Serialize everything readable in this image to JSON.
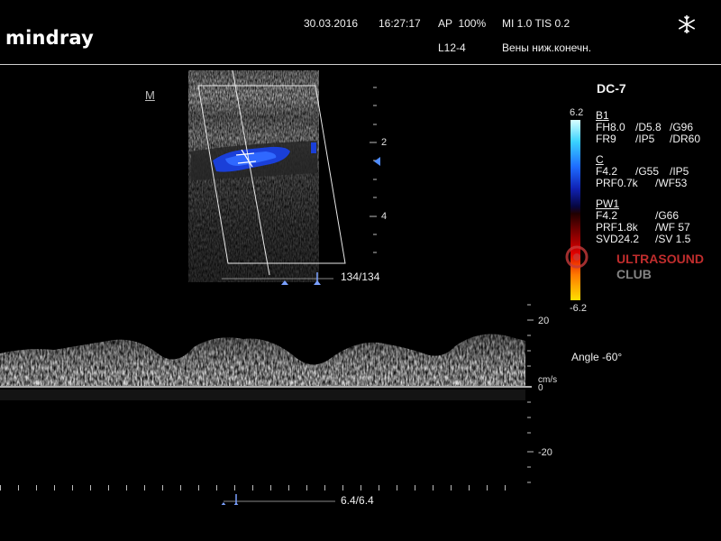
{
  "header": {
    "brand": "mindray",
    "date": "30.03.2016",
    "time": "16:27:17",
    "ap": "AP  100%",
    "mi_tis": "MI 1.0 TIS 0.2",
    "probe": "L12-4",
    "preset": "Вены ниж.конечн.",
    "freeze_icon": "snowflake-icon"
  },
  "image_panel": {
    "m_marker": "M",
    "depth_labels": [
      "2",
      "4"
    ],
    "frame_counter": "134/134"
  },
  "params": {
    "title": "DC-7",
    "b1": {
      "label": "B1",
      "rows": [
        [
          "FH8.0",
          "/D5.8",
          "/G96"
        ],
        [
          "FR9",
          "/IP5",
          "/DR60"
        ]
      ]
    },
    "c": {
      "label": "C",
      "rows": [
        [
          "F4.2",
          "/G55",
          "/IP5"
        ],
        [
          "PRF0.7k",
          "/WF53"
        ]
      ]
    },
    "pw1": {
      "label": "PW1",
      "rows": [
        [
          "F4.2",
          "/G66"
        ],
        [
          "PRF1.8k",
          "/WF 57"
        ],
        [
          "SVD24.2",
          "/SV 1.5"
        ]
      ]
    }
  },
  "colorbar": {
    "top": "6.2",
    "bottom": "-6.2"
  },
  "watermark": {
    "line1": "ULTRASOUND",
    "line2": "CLUB"
  },
  "doppler": {
    "angle": "Angle -60°",
    "unit": "cm/s",
    "scale_labels": [
      "20",
      "0",
      "-20"
    ],
    "sweep_counter": "6.4/6.4"
  }
}
